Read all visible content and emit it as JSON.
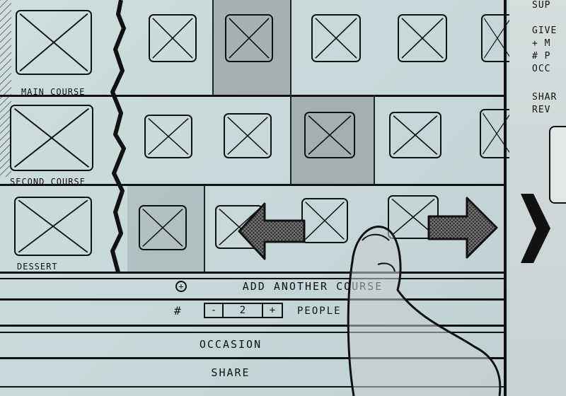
{
  "rows": [
    {
      "label": "MAIN COURSE"
    },
    {
      "label": "SECOND COURSE"
    },
    {
      "label": "DESSERT"
    }
  ],
  "actions": {
    "add_course_label": "ADD ANOTHER COURSE",
    "people_prefix": "#",
    "people_minus": "-",
    "people_value": "2",
    "people_plus": "+",
    "people_label": "PEOPLE",
    "occasion_label": "OCCASION",
    "share_label": "SHARE"
  },
  "side_notes": [
    "SUP",
    "GIVE",
    "+ M",
    "# P",
    "OCC",
    "SHAR",
    "REV"
  ],
  "icons": {
    "placeholder": "image-placeholder-icon",
    "scroll_left": "left-arrow-icon",
    "scroll_right": "right-arrow-icon",
    "next_page": "chevron-right-icon",
    "add": "plus-circle-icon",
    "gesture": "finger-swipe-icon"
  },
  "colors": {
    "paper": "#c9dbdc",
    "ink": "#111111",
    "highlight_cell": "#8f9698"
  }
}
